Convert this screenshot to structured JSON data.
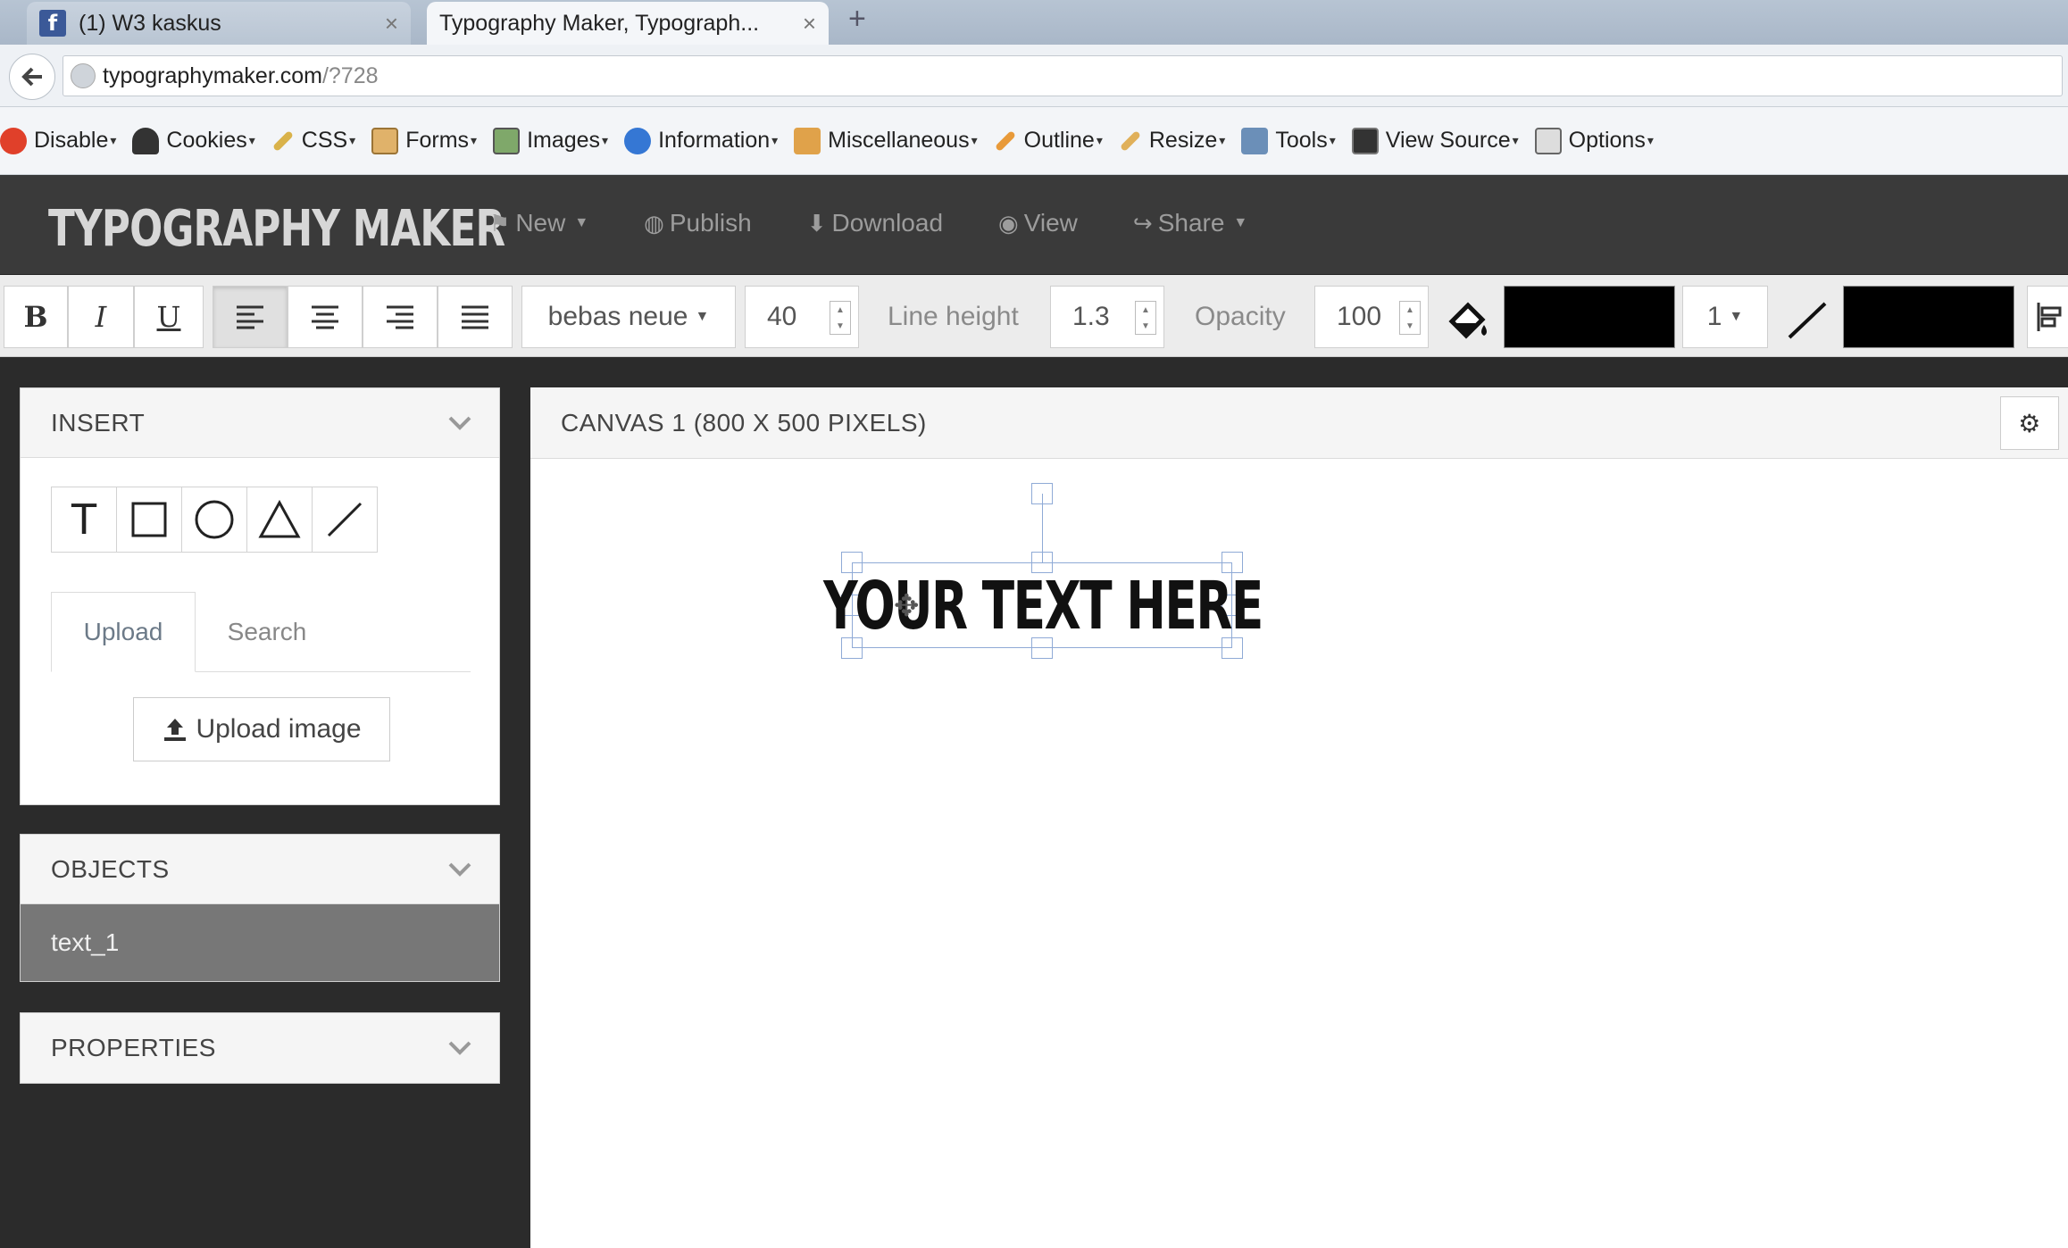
{
  "browser": {
    "tabs": [
      {
        "label": "(1) W3 kaskus",
        "icon": "facebook-icon"
      },
      {
        "label": "Typography Maker, Typograph...",
        "icon": "page-icon"
      }
    ],
    "close_glyph": "×",
    "new_tab_glyph": "+",
    "url_host": "typographymaker.com",
    "url_path": "/?728"
  },
  "devbar": {
    "items": [
      "Disable",
      "Cookies",
      "CSS",
      "Forms",
      "Images",
      "Information",
      "Miscellaneous",
      "Outline",
      "Resize",
      "Tools",
      "View Source",
      "Options"
    ]
  },
  "app": {
    "brand": "TYPOGRAPHY MAKER",
    "nav": [
      {
        "label": "New",
        "icon": "flag-icon",
        "has_menu": true
      },
      {
        "label": "Publish",
        "icon": "globe-icon",
        "has_menu": false
      },
      {
        "label": "Download",
        "icon": "download-icon",
        "has_menu": false
      },
      {
        "label": "View",
        "icon": "eye-icon",
        "has_menu": false
      },
      {
        "label": "Share",
        "icon": "share-icon",
        "has_menu": true
      }
    ]
  },
  "format": {
    "bold": "B",
    "italic": "I",
    "underline": "U",
    "font": "bebas neue",
    "font_size": "40",
    "line_height_label": "Line height",
    "line_height": "1.3",
    "opacity_label": "Opacity",
    "opacity": "100",
    "fill_color": "#000000",
    "stroke_width": "1",
    "stroke_color": "#000000"
  },
  "sidebar": {
    "insert": {
      "title": "INSERT",
      "tools": [
        "T"
      ],
      "tabs": [
        "Upload",
        "Search"
      ],
      "upload_label": "Upload image"
    },
    "objects": {
      "title": "OBJECTS",
      "items": [
        "text_1"
      ]
    },
    "properties": {
      "title": "PROPERTIES"
    }
  },
  "canvas": {
    "title": "CANVAS 1 (800 X 500 PIXELS)",
    "text_object": "YOUR TEXT HERE"
  }
}
